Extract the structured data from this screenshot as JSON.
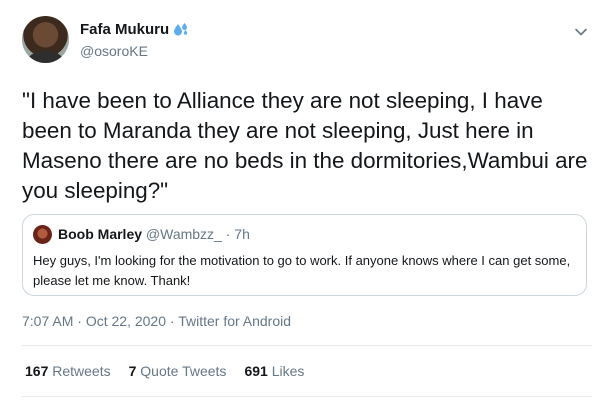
{
  "author": {
    "display_name": "Fafa Mukuru",
    "handle": "@osoroKE",
    "name_emoji_icon": "water-droplets-icon"
  },
  "menu": {
    "icon": "chevron-down-icon"
  },
  "tweet": {
    "text": "\"I have been to Alliance they are not sleeping, I have been to Maranda they are not sleeping, Just here in Maseno there are no beds in the dormitories,Wambui are you sleeping?\""
  },
  "quoted_tweet": {
    "name": "Boob Marley",
    "handle": "@Wambzz_",
    "separator": "·",
    "time": "7h",
    "text": "Hey guys, I'm looking for the motivation to go to work. If anyone knows where I can get some, please let me know. Thank!"
  },
  "meta": {
    "time": "7:07 AM",
    "separator1": "·",
    "date": "Oct 22, 2020",
    "separator2": "·",
    "source": "Twitter for Android"
  },
  "stats": {
    "retweets_count": "167",
    "retweets_label": "Retweets",
    "quotes_count": "7",
    "quotes_label": "Quote Tweets",
    "likes_count": "691",
    "likes_label": "Likes"
  },
  "colors": {
    "text_primary": "#14171a",
    "text_secondary": "#657786",
    "border": "#ccd6dd",
    "divider": "#e6ecf0",
    "emoji_blue": "#5dadec"
  }
}
